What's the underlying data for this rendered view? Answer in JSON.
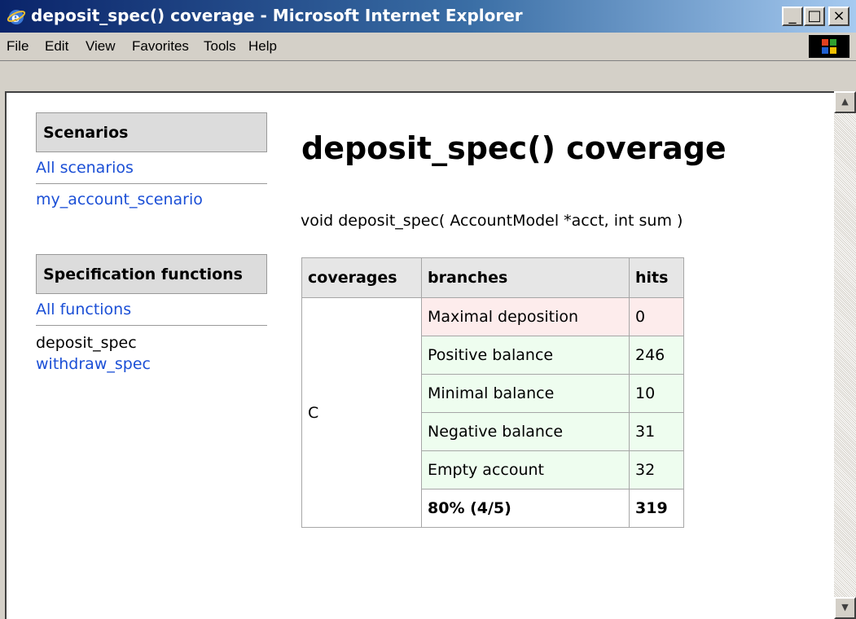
{
  "window": {
    "title": "deposit_spec() coverage - Microsoft Internet Explorer",
    "buttons": {
      "minimize": "_",
      "maximize": "□",
      "close": "×"
    }
  },
  "menu": {
    "items": [
      "File",
      "Edit",
      "View",
      "Favorites",
      "Tools",
      "Help"
    ]
  },
  "sidebar": {
    "scenarios_header": "Scenarios",
    "all_scenarios": "All scenarios",
    "scenario_item": "my_account_scenario",
    "functions_header": "Specification functions",
    "all_functions": "All functions",
    "current_function": "deposit_spec",
    "other_function": "withdraw_spec"
  },
  "main": {
    "title": "deposit_spec() coverage",
    "signature": "void deposit_spec( AccountModel *acct, int sum )",
    "table": {
      "headers": [
        "coverages",
        "branches",
        "hits"
      ],
      "coverage_name": "C",
      "rows": [
        {
          "branch": "Maximal deposition",
          "hits": "0",
          "status": "fail"
        },
        {
          "branch": "Positive balance",
          "hits": "246",
          "status": "ok"
        },
        {
          "branch": "Minimal balance",
          "hits": "10",
          "status": "ok"
        },
        {
          "branch": "Negative balance",
          "hits": "31",
          "status": "ok"
        },
        {
          "branch": "Empty account",
          "hits": "32",
          "status": "ok"
        }
      ],
      "total": {
        "branch": "80% (4/5)",
        "hits": "319"
      }
    }
  },
  "colors": {
    "link": "#1b4fd6",
    "fail_row": "#fdecec",
    "ok_row": "#eefdef",
    "titlebar_start": "#0a246a",
    "titlebar_end": "#a6caf0"
  },
  "icons": {
    "app": "ie-icon",
    "windows_logo": "windows-logo-icon"
  }
}
